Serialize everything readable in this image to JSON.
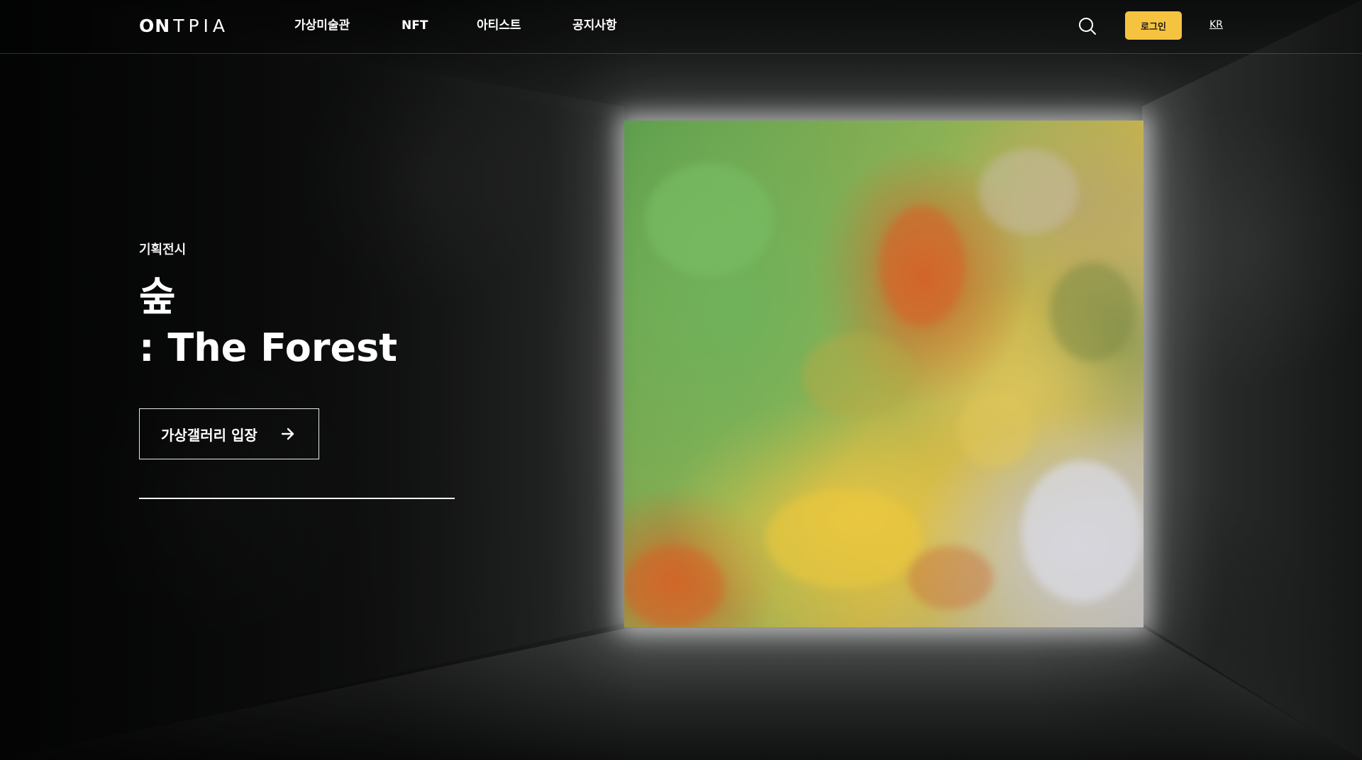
{
  "header": {
    "logo_bold": "ON",
    "logo_light": "TPIA",
    "nav": [
      "가상미술관",
      "NFT",
      "아티스트",
      "공지사항"
    ],
    "login_label": "로그인",
    "lang_label": "KR",
    "search_icon": "search-icon"
  },
  "hero": {
    "eyebrow": "기획전시",
    "title_ko": "숲",
    "title_en": ": The Forest",
    "enter_label": "가상갤러리 입장",
    "enter_icon": "arrow-right-icon"
  },
  "colors": {
    "accent": "#f6c340",
    "text": "#ffffff",
    "background": "#1b1c1c"
  }
}
